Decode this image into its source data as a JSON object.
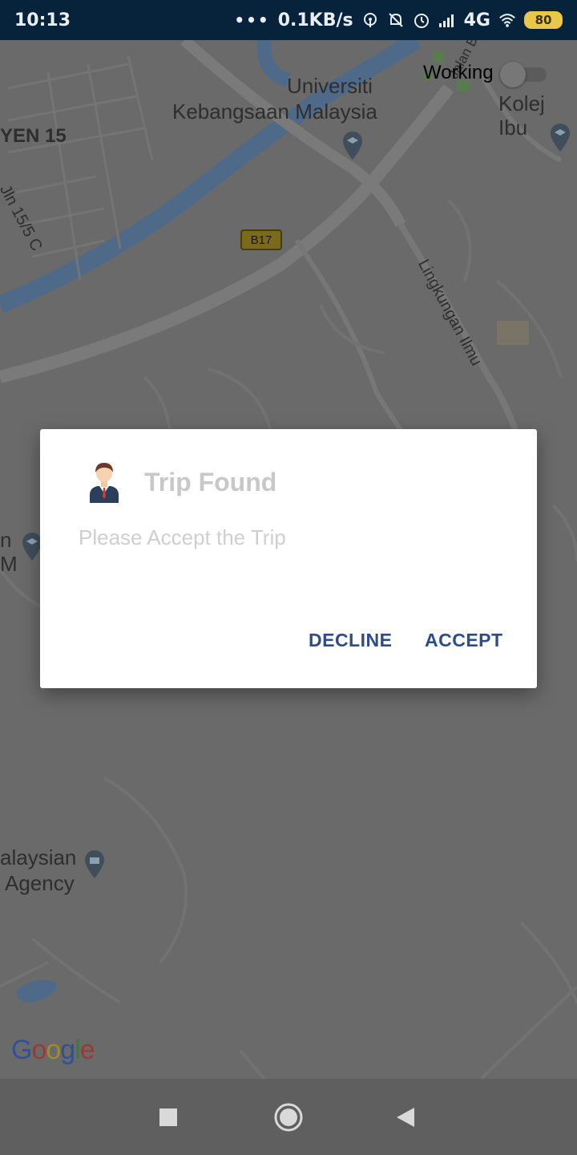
{
  "status_bar": {
    "time": "10:13",
    "dots": "•••",
    "net_speed": "0.1KB/s",
    "network": "4G",
    "battery": "80"
  },
  "map": {
    "labels": {
      "universiti_line1": "Universiti",
      "universiti_line2": "Kebangsaan Malaysia",
      "kolej": "Kolej Ibu",
      "yen": "YEN 15",
      "jln": "Jln 15/5 C",
      "road_shield": "B17",
      "lingkungan": "Lingkungan Ilmu",
      "jalan": "Jalan B",
      "left_n": "n",
      "left_m": "M",
      "malaysian": "alaysian",
      "agency": "Agency"
    },
    "google_logo": "Google"
  },
  "toggle": {
    "label": "Working",
    "state": "off"
  },
  "dialog": {
    "title": "Trip Found",
    "message": "Please Accept the Trip",
    "decline_label": "DECLINE",
    "accept_label": "ACCEPT",
    "icon": "person-avatar-icon"
  },
  "navbar": {
    "recents_icon": "square-icon",
    "home_icon": "circle-icon",
    "back_icon": "triangle-back-icon"
  },
  "colors": {
    "status_bar_bg": "#06233b",
    "accent": "#2f4c8a",
    "dim_overlay": "#6a6a6a"
  }
}
